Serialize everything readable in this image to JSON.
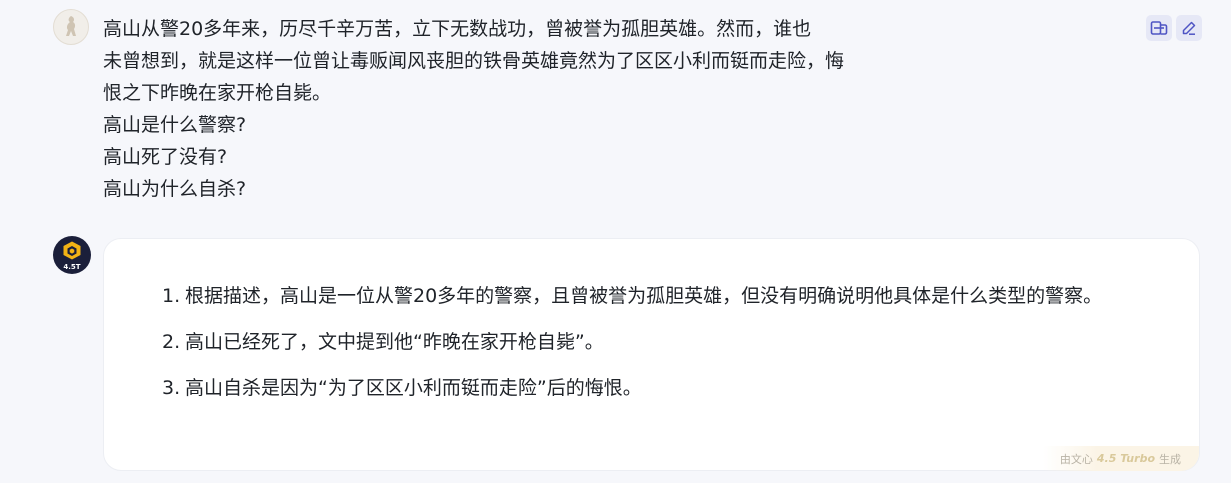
{
  "user_message": {
    "lines": [
      "高山从警20多年来，历尽千辛万苦，立下无数战功，曾被誉为孤胆英雄。然而，谁也",
      "未曾想到，就是这样一位曾让毒贩闻风丧胆的铁骨英雄竟然为了区区小利而铤而走险，悔",
      "恨之下昨晚在家开枪自毙。",
      "高山是什么警察?",
      "高山死了没有?",
      "高山为什么自杀?"
    ],
    "avatar_icon": "rider-avatar-icon",
    "actions": [
      {
        "icon": "copy-icon"
      },
      {
        "icon": "edit-icon"
      }
    ]
  },
  "bot_message": {
    "avatar_badge": "4.5T",
    "items": [
      {
        "num": "1.",
        "text": "根据描述，高山是一位从警20多年的警察，且曾被誉为孤胆英雄，但没有明确说明他具体是什么类型的警察。"
      },
      {
        "num": "2.",
        "text": "高山已经死了，文中提到他“昨晚在家开枪自毙”。"
      },
      {
        "num": "3.",
        "text": "高山自杀是因为“为了区区小利而铤而走险”后的悔恨。"
      }
    ],
    "footer": {
      "prefix": "由文心",
      "model": "4.5 Turbo",
      "suffix": "生成"
    }
  },
  "colors": {
    "page_bg": "#f6f7fb",
    "card_bg": "#ffffff",
    "action_bg": "#e6e8f6",
    "action_icon": "#4f55c4"
  }
}
